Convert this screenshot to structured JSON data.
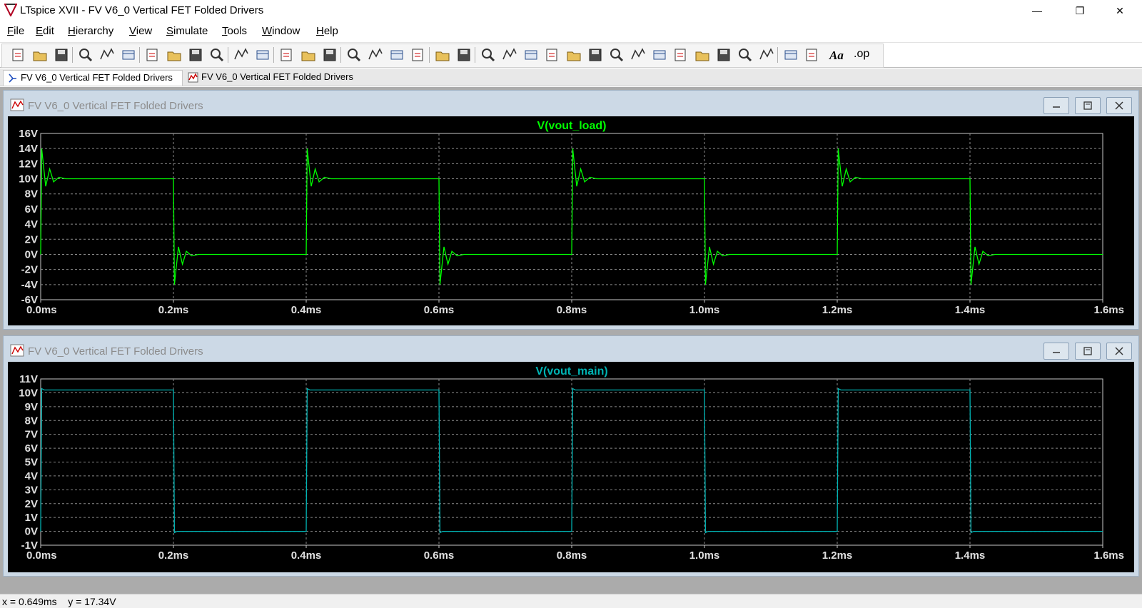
{
  "window": {
    "title": "LTspice XVII - FV V6_0 Vertical FET Folded Drivers",
    "minimize": "—",
    "restore": "❐",
    "close": "✕"
  },
  "menu": [
    {
      "label": "File",
      "key": "F",
      "rest": "ile"
    },
    {
      "label": "Edit",
      "key": "E",
      "rest": "dit"
    },
    {
      "label": "Hierarchy",
      "key": "H",
      "rest": "ierarchy"
    },
    {
      "label": "View",
      "key": "V",
      "rest": "iew"
    },
    {
      "label": "Simulate",
      "key": "S",
      "rest": "imulate"
    },
    {
      "label": "Tools",
      "key": "T",
      "rest": "ools"
    },
    {
      "label": "Window",
      "key": "W",
      "rest": "indow"
    },
    {
      "label": "Help",
      "key": "H",
      "rest": "elp"
    }
  ],
  "toolbar": {
    "icons": [
      "new-schematic-icon",
      "open-icon",
      "save-icon",
      "control-panel-icon",
      "run-icon",
      "halt-icon",
      "zoom-in-icon",
      "zoom-pan-icon",
      "zoom-out-icon",
      "zoom-fit-icon",
      "autorange-icon",
      "grid-icon",
      "tile-horizontal-icon",
      "cascade-icon",
      "tile-vertical-icon",
      "cut-icon",
      "copy-icon",
      "paste-icon",
      "find-icon",
      "print-icon",
      "print-preview-icon",
      "draw-wire-icon",
      "ground-icon",
      "label-net-icon",
      "resistor-icon",
      "capacitor-icon",
      "inductor-icon",
      "diode-icon",
      "component-icon",
      "move-icon",
      "drag-icon",
      "undo-icon",
      "redo-icon",
      "rotate-icon",
      "mirror-icon",
      "text-icon",
      "spice-directive-icon"
    ],
    "text_label": "Aa",
    "op_label": ".op"
  },
  "tabs": [
    {
      "label": "FV V6_0 Vertical FET Folded Drivers",
      "kind": "schematic",
      "active": true
    },
    {
      "label": "FV V6_0 Vertical FET Folded Drivers",
      "kind": "waveform",
      "active": false
    }
  ],
  "panes": [
    {
      "title": "FV V6_0 Vertical FET Folded Drivers"
    },
    {
      "title": "FV V6_0 Vertical FET Folded Drivers"
    }
  ],
  "chart_data": [
    {
      "type": "line",
      "title": "V(vout_load)",
      "color": "#00ff00",
      "xlabel": "",
      "ylabel": "",
      "x_unit": "ms",
      "xlim": [
        0,
        1.6
      ],
      "ylim": [
        -6,
        16
      ],
      "x_ticks": [
        "0.0ms",
        "0.2ms",
        "0.4ms",
        "0.6ms",
        "0.8ms",
        "1.0ms",
        "1.2ms",
        "1.4ms",
        "1.6ms"
      ],
      "y_ticks": [
        "16V",
        "14V",
        "12V",
        "10V",
        "8V",
        "6V",
        "4V",
        "2V",
        "0V",
        "-2V",
        "-4V",
        "-6V"
      ],
      "grid": true,
      "legend": "none",
      "series": [
        {
          "name": "V(vout_load)",
          "period_ms": 0.4,
          "duty": 0.5,
          "high": 10,
          "low": 0,
          "rise_peak": 14,
          "fall_peak": -4,
          "ringing": [
            {
              "t_offset_ms": 0.0,
              "v": 14.0
            },
            {
              "t_offset_ms": 0.006,
              "v": 9.0
            },
            {
              "t_offset_ms": 0.012,
              "v": 11.3
            },
            {
              "t_offset_ms": 0.018,
              "v": 9.6
            },
            {
              "t_offset_ms": 0.026,
              "v": 10.2
            },
            {
              "t_offset_ms": 0.036,
              "v": 10.0
            }
          ],
          "edges_ms": [
            0.0,
            0.2,
            0.4,
            0.6,
            0.8,
            1.0,
            1.2,
            1.4
          ]
        }
      ]
    },
    {
      "type": "line",
      "title": "V(vout_main)",
      "color": "#00b3b3",
      "xlabel": "",
      "ylabel": "",
      "x_unit": "ms",
      "xlim": [
        0,
        1.6
      ],
      "ylim": [
        -1,
        11
      ],
      "x_ticks": [
        "0.0ms",
        "0.2ms",
        "0.4ms",
        "0.6ms",
        "0.8ms",
        "1.0ms",
        "1.2ms",
        "1.4ms",
        "1.6ms"
      ],
      "y_ticks": [
        "11V",
        "10V",
        "9V",
        "8V",
        "7V",
        "6V",
        "5V",
        "4V",
        "3V",
        "2V",
        "1V",
        "0V",
        "-1V"
      ],
      "grid": true,
      "legend": "none",
      "series": [
        {
          "name": "V(vout_main)",
          "period_ms": 0.4,
          "duty": 0.5,
          "high": 10.2,
          "low": 0,
          "rise_peak": 10.3,
          "fall_peak": -0.1,
          "edges_ms": [
            0.0,
            0.2,
            0.4,
            0.6,
            0.8,
            1.0,
            1.2,
            1.4
          ]
        }
      ]
    }
  ],
  "status": {
    "x_label": "x = 0.649ms",
    "y_label": "y = 17.34V"
  }
}
